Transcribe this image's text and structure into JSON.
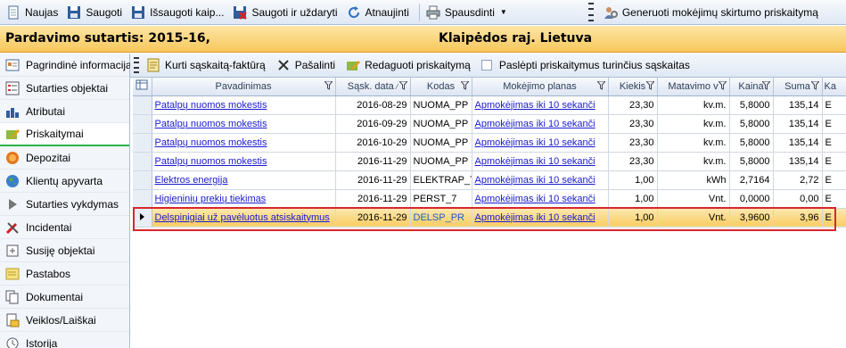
{
  "toolbar": {
    "new": "Naujas",
    "save": "Saugoti",
    "save_as": "Išsaugoti kaip...",
    "save_close": "Saugoti ir uždaryti",
    "refresh": "Atnaujinti",
    "print": "Spausdinti",
    "generate": "Generuoti mokėjimų skirtumo priskaitymą"
  },
  "title": {
    "contract": "Pardavimo sutartis: 2015-16,",
    "location": "Klaipėdos raj. Lietuva"
  },
  "sidebar": {
    "items": [
      {
        "label": "Pagrindinė informacija",
        "icon": "info-icon"
      },
      {
        "label": "Sutarties objektai",
        "icon": "list-icon"
      },
      {
        "label": "Atributai",
        "icon": "bars-icon"
      },
      {
        "label": "Priskaitymai",
        "icon": "edit-icon",
        "active": true
      },
      {
        "label": "Depozitai",
        "icon": "coin-icon"
      },
      {
        "label": "Klientų apyvarta",
        "icon": "globe-icon"
      },
      {
        "label": "Sutarties vykdymas",
        "icon": "play-icon"
      },
      {
        "label": "Incidentai",
        "icon": "tools-icon"
      },
      {
        "label": "Susiję objektai",
        "icon": "link-icon"
      },
      {
        "label": "Pastabos",
        "icon": "note-icon"
      },
      {
        "label": "Dokumentai",
        "icon": "documents-icon"
      },
      {
        "label": "Veiklos/Laiškai",
        "icon": "mail-icon"
      },
      {
        "label": "Istorija",
        "icon": "history-icon"
      }
    ]
  },
  "actions": {
    "create_invoice": "Kurti sąskaitą-faktūrą",
    "remove": "Pašalinti",
    "edit": "Redaguoti priskaitymą",
    "hide": "Paslėpti priskaitymus turinčius sąskaitas"
  },
  "grid": {
    "columns": [
      "Pavadinimas",
      "Sąsk. data",
      "Kodas",
      "Mokėjimo planas",
      "Kiekis",
      "Matavimo v",
      "Kaina",
      "Suma",
      "Ka"
    ],
    "rows": [
      {
        "name": "Patalpų nuomos mokestis",
        "date": "2016-08-29",
        "code": "NUOMA_PP",
        "plan": "Apmokėjimas iki 10 sekanči",
        "qty": "23,30",
        "unit": "kv.m.",
        "price": "5,8000",
        "sum": "135,14",
        "extra": "E"
      },
      {
        "name": "Patalpų nuomos mokestis",
        "date": "2016-09-29",
        "code": "NUOMA_PP",
        "plan": "Apmokėjimas iki 10 sekanči",
        "qty": "23,30",
        "unit": "kv.m.",
        "price": "5,8000",
        "sum": "135,14",
        "extra": "E"
      },
      {
        "name": "Patalpų nuomos mokestis",
        "date": "2016-10-29",
        "code": "NUOMA_PP",
        "plan": "Apmokėjimas iki 10 sekanči",
        "qty": "23,30",
        "unit": "kv.m.",
        "price": "5,8000",
        "sum": "135,14",
        "extra": "E"
      },
      {
        "name": "Patalpų nuomos mokestis",
        "date": "2016-11-29",
        "code": "NUOMA_PP",
        "plan": "Apmokėjimas iki 10 sekanči",
        "qty": "23,30",
        "unit": "kv.m.",
        "price": "5,8000",
        "sum": "135,14",
        "extra": "E"
      },
      {
        "name": "Elektros energija",
        "date": "2016-11-29",
        "code": "ELEKTRAP_T",
        "plan": "Apmokėjimas iki 10 sekanči",
        "qty": "1,00",
        "unit": "kWh",
        "price": "2,7164",
        "sum": "2,72",
        "extra": "E"
      },
      {
        "name": "Higieninių prekių tiekimas",
        "date": "2016-11-29",
        "code": "PERST_7",
        "plan": "Apmokėjimas iki 10 sekanči",
        "qty": "1,00",
        "unit": "Vnt.",
        "price": "0,0000",
        "sum": "0,00",
        "extra": "E"
      },
      {
        "name": "Delspinigiai už pavėluotus atsiskaitymus",
        "date": "2016-11-29",
        "code": "DELSP_PR",
        "plan": "Apmokėjimas iki 10 sekanči",
        "qty": "1,00",
        "unit": "Vnt.",
        "price": "3,9600",
        "sum": "3,96",
        "extra": "E",
        "selected": true
      }
    ]
  }
}
